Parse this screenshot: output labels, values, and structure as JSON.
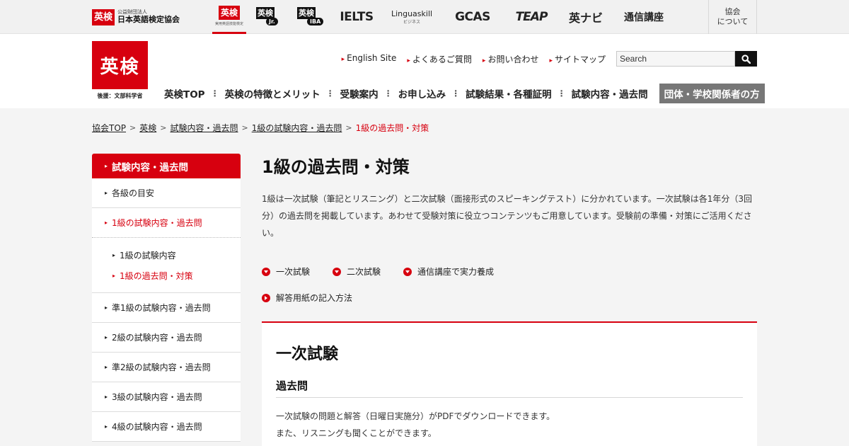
{
  "topbar": {
    "logo_box": "英検",
    "logo_small": "公益財団法人",
    "logo_big": "日本英語検定協会",
    "brands": {
      "eiken": "英検",
      "eiken_caption": "実用英語技能検定",
      "jr_box": "英検",
      "jr_tag": "Jr.",
      "iba_box": "英検",
      "iba_tag": "IBA",
      "ielts": "IELTS",
      "linguaskill": "Linguaskill",
      "linguaskill_sub": "ビジネス",
      "gcas": "GCAS",
      "teap": "TEAP",
      "enavi": "英ナビ",
      "tsushin": "通信講座"
    },
    "kyokai_line1": "協会",
    "kyokai_line2": "について"
  },
  "header": {
    "logo_text": "英検",
    "logo_sub": "後援：文部科学省",
    "util_nav": [
      "English Site",
      "よくあるご質問",
      "お問い合わせ",
      "サイトマップ"
    ],
    "search_placeholder": "Search",
    "search_value": "Search",
    "gnav": [
      "英検TOP",
      "英検の特徴とメリット",
      "受験案内",
      "お申し込み",
      "試験結果・各種証明",
      "試験内容・過去問"
    ],
    "gnav_dark": "団体・学校関係者の方"
  },
  "breadcrumb": {
    "items": [
      "協会TOP",
      "英検",
      "試験内容・過去問",
      "1級の試験内容・過去問"
    ],
    "current": "1級の過去問・対策",
    "separator": ">"
  },
  "sidebar": {
    "heading": "試験内容・過去問",
    "items_top": [
      "各級の目安",
      "1級の試験内容・過去問"
    ],
    "sub_items": [
      "1級の試験内容",
      "1級の過去問・対策"
    ],
    "items_bottom": [
      "準1級の試験内容・過去問",
      "2級の試験内容・過去問",
      "準2級の試験内容・過去問",
      "3級の試験内容・過去問",
      "4級の試験内容・過去問"
    ]
  },
  "content": {
    "title": "1級の過去問・対策",
    "intro": "1級は一次試験（筆記とリスニング）と二次試験（面接形式のスピーキングテスト）に分かれています。一次試験は各1年分（3回分）の過去問を掲載しています。あわせて受験対策に役立つコンテンツもご用意しています。受験前の準備・対策にご活用ください。",
    "anchors": [
      "一次試験",
      "二次試験",
      "通信講座で実力養成",
      "解答用紙の記入方法"
    ],
    "panel_title": "一次試験",
    "panel_sub": "過去問",
    "panel_line1": "一次試験の問題と解答（日曜日実施分）がPDFでダウンロードできます。",
    "panel_line2": "また、リスニングも聞くことができます。"
  },
  "colors": {
    "accent": "#d7000f",
    "dark_nav": "#777777"
  }
}
